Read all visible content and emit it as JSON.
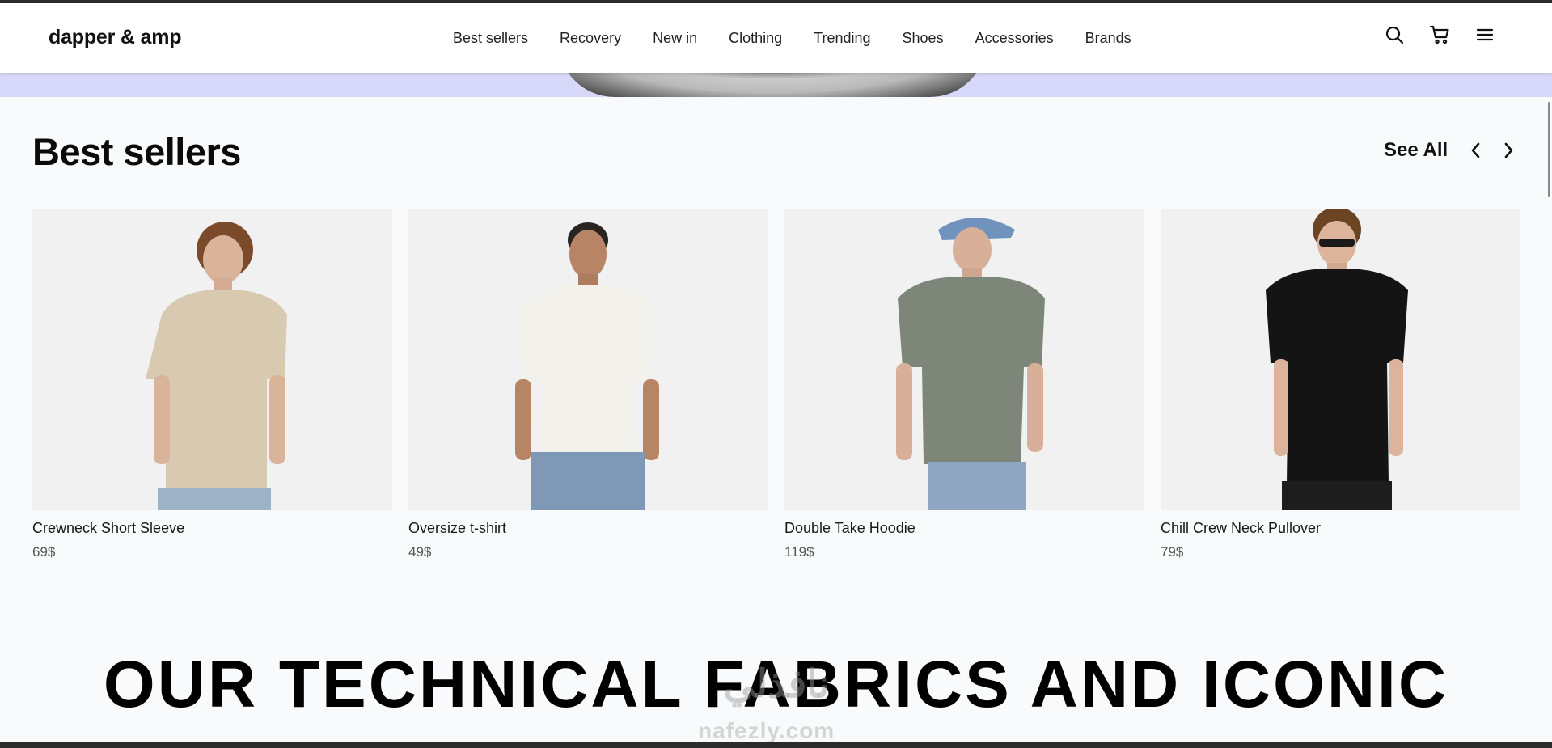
{
  "header": {
    "logo": "dapper & amp",
    "nav": [
      {
        "label": "Best sellers"
      },
      {
        "label": "Recovery"
      },
      {
        "label": "New in"
      },
      {
        "label": "Clothing"
      },
      {
        "label": "Trending"
      },
      {
        "label": "Shoes"
      },
      {
        "label": "Accessories"
      },
      {
        "label": "Brands"
      }
    ],
    "icons": [
      "search-icon",
      "cart-icon",
      "menu-icon"
    ]
  },
  "best_sellers": {
    "title": "Best sellers",
    "see_all": "See All",
    "products": [
      {
        "name": "Crewneck Short Sleeve",
        "price": "69$",
        "shirt_color": "#d8cab1",
        "pants_color": "#9eb3c8"
      },
      {
        "name": "Oversize t-shirt",
        "price": "49$",
        "shirt_color": "#f2f1ec",
        "pants_color": "#7f98b6"
      },
      {
        "name": "Double Take Hoodie",
        "price": "119$",
        "shirt_color": "#7d8678",
        "pants_color": "#8ea6c2"
      },
      {
        "name": "Chill Crew Neck Pullover",
        "price": "79$",
        "shirt_color": "#141414",
        "pants_color": "#1d1d1d"
      }
    ]
  },
  "banner": {
    "text": "OUR TECHNICAL FABRICS AND ICONIC"
  },
  "watermark": {
    "text": "nafezly.com",
    "mark": "نافذلي"
  }
}
